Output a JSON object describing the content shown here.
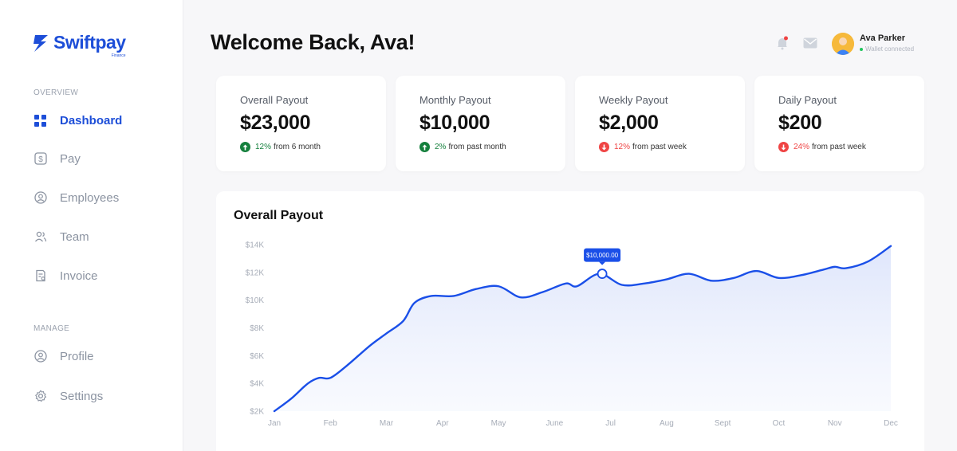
{
  "brand": {
    "name": "Swiftpay",
    "tagline": "Finance"
  },
  "sidebar": {
    "overview_label": "OVERVIEW",
    "manage_label": "MANAGE",
    "overview_items": [
      {
        "label": "Dashboard",
        "icon": "grid-icon",
        "active": true
      },
      {
        "label": "Pay",
        "icon": "dollar-icon"
      },
      {
        "label": "Employees",
        "icon": "user-circle-icon"
      },
      {
        "label": "Team",
        "icon": "users-icon"
      },
      {
        "label": "Invoice",
        "icon": "invoice-icon"
      }
    ],
    "manage_items": [
      {
        "label": "Profile",
        "icon": "profile-icon"
      },
      {
        "label": "Settings",
        "icon": "gear-icon"
      }
    ]
  },
  "header": {
    "title": "Welcome Back, Ava!",
    "user": {
      "name": "Ava Parker",
      "status": "Wallet connected"
    }
  },
  "stats": [
    {
      "title": "Overall Payout",
      "value": "$23,000",
      "trend": "up",
      "pct": "12%",
      "period": "from 6 month"
    },
    {
      "title": "Monthly Payout",
      "value": "$10,000",
      "trend": "up",
      "pct": "2%",
      "period": "from past month"
    },
    {
      "title": "Weekly Payout",
      "value": "$2,000",
      "trend": "down",
      "pct": "12%",
      "period": "from past week"
    },
    {
      "title": "Daily Payout",
      "value": "$200",
      "trend": "down",
      "pct": "24%",
      "period": "from past week"
    }
  ],
  "colors": {
    "accent": "#1d4ed8",
    "line": "#1a4fe8",
    "up": "#15803d",
    "down": "#ef4444"
  },
  "chart_data": {
    "type": "area",
    "title": "Overall Payout",
    "categories": [
      "Jan",
      "Feb",
      "Mar",
      "Apr",
      "May",
      "June",
      "Jul",
      "Aug",
      "Sept",
      "Oct",
      "Nov",
      "Dec"
    ],
    "yticks": [
      "$2K",
      "$4K",
      "$6K",
      "$8K",
      "$10K",
      "$12K",
      "$14K"
    ],
    "ylim": [
      2000,
      14000
    ],
    "grid": false,
    "series": [
      {
        "points": [
          [
            0,
            2000
          ],
          [
            0.3,
            2900
          ],
          [
            0.6,
            4000
          ],
          [
            0.8,
            4400
          ],
          [
            1,
            4400
          ],
          [
            1.3,
            5300
          ],
          [
            1.7,
            6700
          ],
          [
            2,
            7600
          ],
          [
            2.3,
            8500
          ],
          [
            2.5,
            9800
          ],
          [
            2.8,
            10300
          ],
          [
            3.2,
            10300
          ],
          [
            3.6,
            10800
          ],
          [
            4,
            11000
          ],
          [
            4.4,
            10200
          ],
          [
            4.8,
            10600
          ],
          [
            5.2,
            11200
          ],
          [
            5.4,
            11000
          ],
          [
            5.8,
            11900
          ],
          [
            6.2,
            11100
          ],
          [
            6.6,
            11200
          ],
          [
            7,
            11500
          ],
          [
            7.4,
            11900
          ],
          [
            7.8,
            11400
          ],
          [
            8.2,
            11600
          ],
          [
            8.6,
            12100
          ],
          [
            9,
            11600
          ],
          [
            9.4,
            11800
          ],
          [
            9.8,
            12200
          ],
          [
            10,
            12400
          ],
          [
            10.2,
            12300
          ],
          [
            10.6,
            12800
          ],
          [
            11,
            13900
          ]
        ]
      }
    ],
    "highlight": {
      "x": 5.85,
      "y": 11900,
      "label": "$10,000.00"
    }
  }
}
